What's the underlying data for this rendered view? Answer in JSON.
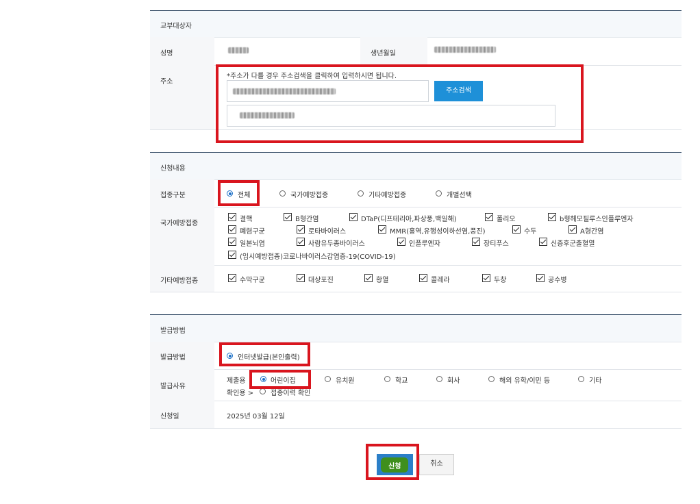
{
  "recipient": {
    "section_title": "교부대상자",
    "name_label": "성명",
    "birth_label": "생년월일",
    "address_label": "주소",
    "address_note": "*주소가 다를 경우 주소검색을 클릭하여 입력하시면 됩니다.",
    "search_button": "주소검색"
  },
  "application": {
    "section_title": "신청내용",
    "type_label": "접종구분",
    "type_options": [
      "전체",
      "국가예방접종",
      "기타예방접종",
      "개별선택"
    ],
    "type_selected": "전체",
    "national_label": "국가예방접종",
    "national_vaccines": [
      "결핵",
      "B형간염",
      "DTaP(디프테리아,파상풍,백일해)",
      "폴리오",
      "b형헤모필루스인플루엔자",
      "폐렴구균",
      "로타바이러스",
      "MMR(홍역,유행성이하선염,풍진)",
      "수두",
      "A형간염",
      "일본뇌염",
      "사람유두종바이러스",
      "인플루엔자",
      "장티푸스",
      "신증후군출혈열",
      "(임시예방접종)코로나바이러스감염증-19(COVID-19)"
    ],
    "other_label": "기타예방접종",
    "other_vaccines": [
      "수막구균",
      "대상포진",
      "황열",
      "콜레라",
      "두창",
      "공수병"
    ]
  },
  "issue": {
    "section_title": "발급방법",
    "method_label": "발급방법",
    "method_option": "인터넷발급(본인출력)",
    "reason_label": "발급사유",
    "submit_prefix": "제출용",
    "submit_options": [
      "어린이집",
      "유치원",
      "학교",
      "회사",
      "해외 유학/이민 등",
      "기타"
    ],
    "confirm_prefix": "확인용 >",
    "confirm_option": "접종이력 확인",
    "date_label": "신청일",
    "date_value": "2025년 03월 12일"
  },
  "actions": {
    "apply": "신청",
    "cancel": "취소"
  },
  "colors": {
    "highlight_red": "#d9151e",
    "primary_blue": "#1e90d8",
    "header_border": "#2d4560"
  }
}
